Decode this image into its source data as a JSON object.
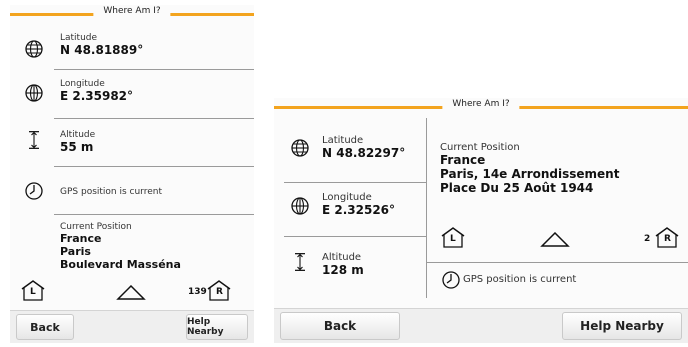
{
  "left": {
    "title": "Where Am I?",
    "latitude": {
      "label": "Latitude",
      "value": "N 48.81889°"
    },
    "longitude": {
      "label": "Longitude",
      "value": "E 2.35982°"
    },
    "altitude": {
      "label": "Altitude",
      "value": "55 m"
    },
    "gps_status": "GPS position is current",
    "current_position": {
      "label": "Current Position",
      "line1": "France",
      "line2": "Paris",
      "line3": "Boulevard Masséna"
    },
    "house_left_letter": "L",
    "house_right_letter": "R",
    "house_number": "139",
    "back_label": "Back",
    "help_label": "Help Nearby"
  },
  "right": {
    "title": "Where Am I?",
    "latitude": {
      "label": "Latitude",
      "value": "N 48.82297°"
    },
    "longitude": {
      "label": "Longitude",
      "value": "E 2.32526°"
    },
    "altitude": {
      "label": "Altitude",
      "value": "128 m"
    },
    "current_position": {
      "label": "Current Position",
      "line1": "France",
      "line2": "Paris, 14e Arrondissement",
      "line3": "Place Du 25 Août 1944"
    },
    "gps_status": "GPS position is current",
    "house_left_letter": "L",
    "house_right_letter": "R",
    "house_number": "2",
    "back_label": "Back",
    "help_label": "Help Nearby"
  },
  "colors": {
    "accent": "#f3a41e",
    "separator": "#9a9a9a"
  }
}
